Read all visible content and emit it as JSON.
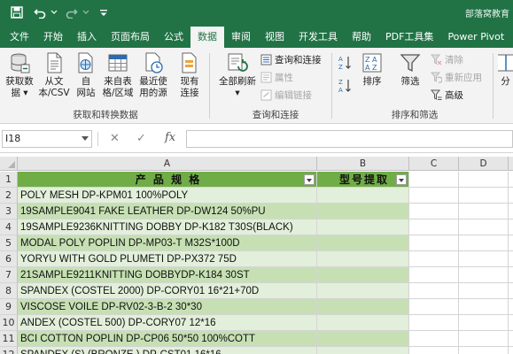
{
  "title": "部落窝教育",
  "quick_access": {
    "save_icon": "save-icon",
    "undo_icon": "undo-icon",
    "redo_icon": "redo-icon"
  },
  "tabs": [
    "文件",
    "开始",
    "插入",
    "页面布局",
    "公式",
    "数据",
    "审阅",
    "视图",
    "开发工具",
    "帮助",
    "PDF工具集",
    "Power Pivot"
  ],
  "active_tab": "数据",
  "ribbon": {
    "get_transform": {
      "label": "获取和转换数据",
      "get_data": "获取数\n据 ▾",
      "from_text": "从文\n本/CSV",
      "from_web": "自\n网站",
      "from_table": "来自表\n格/区域",
      "recent_sources": "最近使\n用的源",
      "existing_connections": "现有\n连接"
    },
    "queries": {
      "label": "查询和连接",
      "refresh_all": "全部刷新",
      "refresh_caret": "▾",
      "queries_connections": "查询和连接",
      "properties": "属性",
      "edit_links": "编辑链接"
    },
    "sort_filter": {
      "label": "排序和筛选",
      "sort": "排序",
      "filter": "筛选",
      "clear": "清除",
      "reapply": "重新应用",
      "advanced": "高级"
    },
    "truncated": "分"
  },
  "formula_bar": {
    "name_box": "I18",
    "cancel": "✕",
    "enter": "✓",
    "fx": "fx",
    "value": ""
  },
  "columns": [
    "A",
    "B",
    "C",
    "D"
  ],
  "rows": [
    {
      "num": "1",
      "a": "产 品 规 格",
      "b": "型号提取"
    },
    {
      "num": "2",
      "a": " POLY MESH     DP-KPM01     100%POLY",
      "b": ""
    },
    {
      "num": "3",
      "a": "19SAMPLE9041 FAKE LEATHER DP-DW124      50%PU",
      "b": ""
    },
    {
      "num": "4",
      "a": "19SAMPLE9236KNITTING DOBBY DP-K182 T30S(BLACK)",
      "b": ""
    },
    {
      "num": "5",
      "a": "MODAL POLY POPLIN DP-MP03-T M32S*100D",
      "b": ""
    },
    {
      "num": "6",
      "a": " YORYU WITH GOLD PLUMETI DP-PX372 75D",
      "b": ""
    },
    {
      "num": "7",
      "a": "21SAMPLE9211KNITTING DOBBYDP-K184 30ST",
      "b": ""
    },
    {
      "num": "8",
      "a": "SPANDEX (COSTEL 2000) DP-CORY01     16*21+70D",
      "b": ""
    },
    {
      "num": "9",
      "a": "VISCOSE VOILE DP-RV02-3-B-2 30*30",
      "b": ""
    },
    {
      "num": "10",
      "a": "ANDEX  (COSTEL 500)   DP-CORY07       12*16",
      "b": ""
    },
    {
      "num": "11",
      "a": "BCI COTTON POPLIN DP-CP06 50*50 100%COTT",
      "b": ""
    },
    {
      "num": "12",
      "a": " SPANDEX (S) (BRONZE ) DP-CST01 16*16",
      "b": ""
    }
  ]
}
